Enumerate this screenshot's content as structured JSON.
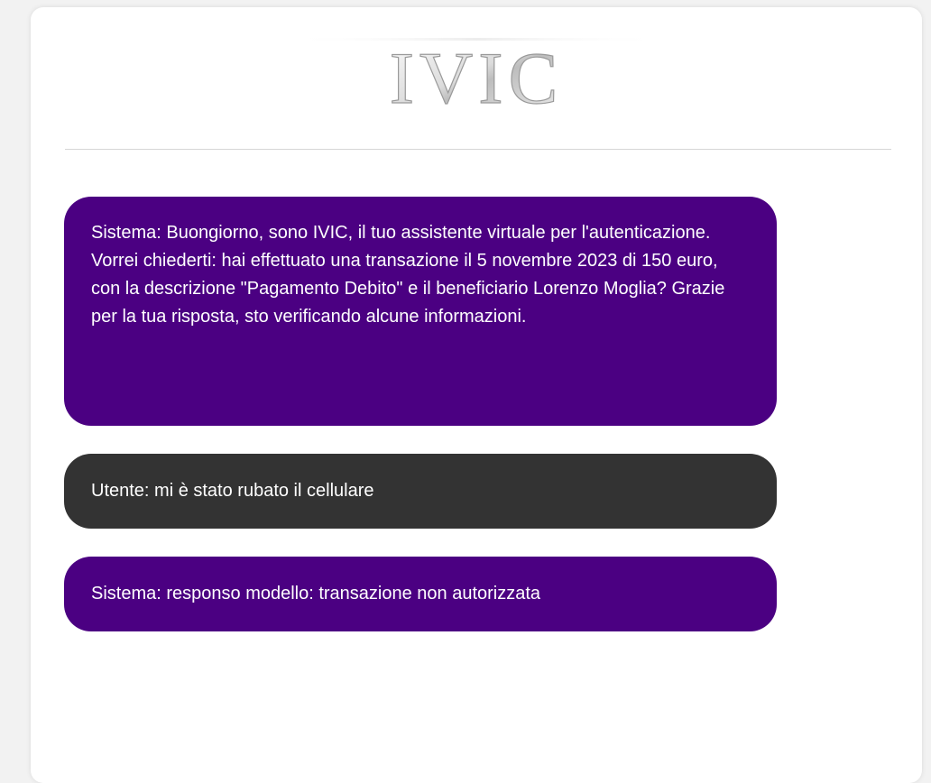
{
  "header": {
    "logo_text": "IVIC"
  },
  "chat": {
    "messages": [
      {
        "role": "system",
        "text": "Sistema: Buongiorno, sono IVIC, il tuo assistente virtuale per l'autenticazione. Vorrei chiederti: hai effettuato una transazione il 5 novembre 2023 di 150 euro, con la descrizione \"Pagamento Debito\" e il beneficiario Lorenzo Moglia? Grazie per la tua risposta, sto verificando alcune informazioni."
      },
      {
        "role": "user",
        "text": "Utente: mi è stato rubato il cellulare"
      },
      {
        "role": "system",
        "text": "Sistema: responso modello: transazione non autorizzata"
      }
    ]
  },
  "colors": {
    "system_bubble": "#4b0082",
    "user_bubble": "#333333",
    "background": "#ffffff"
  }
}
